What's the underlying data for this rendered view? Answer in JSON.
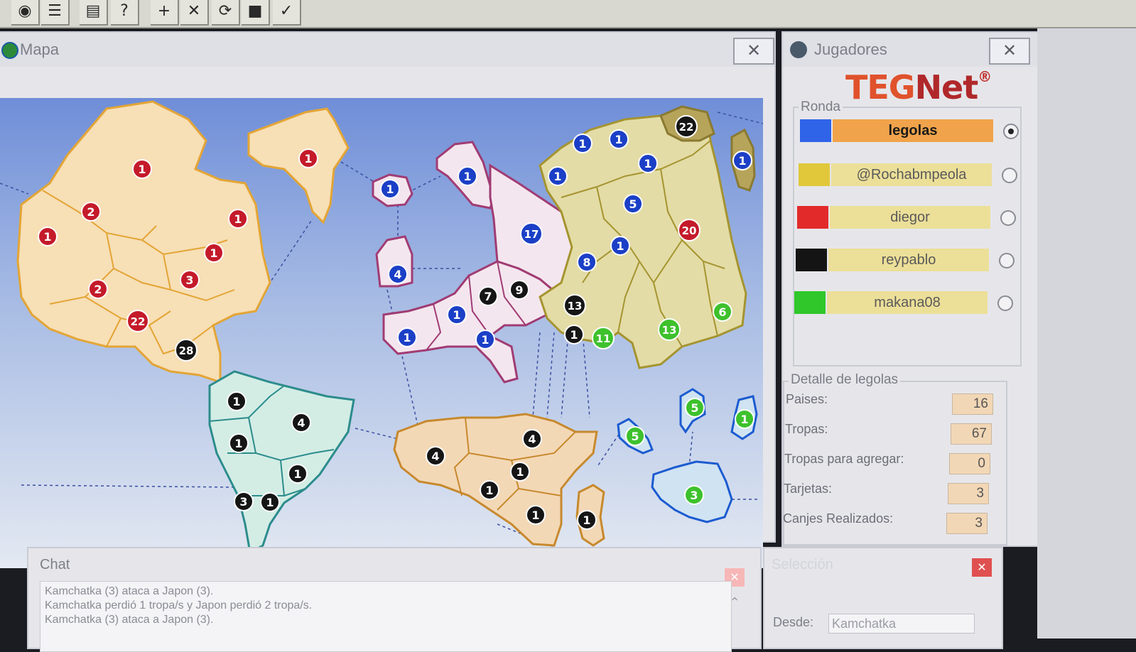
{
  "toolbar": {
    "buttons": [
      {
        "name": "globe-icon",
        "glyph": "◉"
      },
      {
        "name": "list-icon",
        "glyph": "☰"
      },
      {
        "name": "card-icon",
        "glyph": "▤"
      },
      {
        "name": "help-icon",
        "glyph": "?"
      },
      {
        "name": "add-icon",
        "glyph": "+"
      },
      {
        "name": "attack-icon",
        "glyph": "✕"
      },
      {
        "name": "regroup-icon",
        "glyph": "⟳"
      },
      {
        "name": "cards-icon",
        "glyph": "■"
      },
      {
        "name": "end-turn-icon",
        "glyph": "✓"
      }
    ]
  },
  "map_window": {
    "title": "Mapa",
    "close_glyph": "✕"
  },
  "map": {
    "colors": {
      "red": "#c41a2a",
      "blue": "#1b3fc6",
      "black": "#151515",
      "green": "#3ec12d"
    },
    "armies": [
      {
        "owner": "red",
        "count": "1"
      },
      {
        "owner": "red",
        "count": "2"
      },
      {
        "owner": "red",
        "count": "1"
      },
      {
        "owner": "red",
        "count": "1"
      },
      {
        "owner": "red",
        "count": "1"
      },
      {
        "owner": "red",
        "count": "1"
      },
      {
        "owner": "red",
        "count": "3"
      },
      {
        "owner": "red",
        "count": "2"
      },
      {
        "owner": "red",
        "count": "22"
      },
      {
        "owner": "black",
        "count": "28"
      },
      {
        "owner": "black",
        "count": "1"
      },
      {
        "owner": "black",
        "count": "4"
      },
      {
        "owner": "black",
        "count": "1"
      },
      {
        "owner": "black",
        "count": "1"
      },
      {
        "owner": "black",
        "count": "3"
      },
      {
        "owner": "black",
        "count": "1"
      },
      {
        "owner": "blue",
        "count": "1"
      },
      {
        "owner": "blue",
        "count": "4"
      },
      {
        "owner": "blue",
        "count": "1"
      },
      {
        "owner": "blue",
        "count": "1"
      },
      {
        "owner": "blue",
        "count": "17"
      },
      {
        "owner": "black",
        "count": "7"
      },
      {
        "owner": "black",
        "count": "9"
      },
      {
        "owner": "blue",
        "count": "1"
      },
      {
        "owner": "blue",
        "count": "1"
      },
      {
        "owner": "blue",
        "count": "8"
      },
      {
        "owner": "black",
        "count": "13"
      },
      {
        "owner": "black",
        "count": "1"
      },
      {
        "owner": "green",
        "count": "11"
      },
      {
        "owner": "blue",
        "count": "1"
      },
      {
        "owner": "blue",
        "count": "1"
      },
      {
        "owner": "blue",
        "count": "1"
      },
      {
        "owner": "blue",
        "count": "1"
      },
      {
        "owner": "black",
        "count": "22"
      },
      {
        "owner": "blue",
        "count": "1"
      },
      {
        "owner": "blue",
        "count": "5"
      },
      {
        "owner": "red",
        "count": "20"
      },
      {
        "owner": "blue",
        "count": "1"
      },
      {
        "owner": "green",
        "count": "13"
      },
      {
        "owner": "green",
        "count": "6"
      },
      {
        "owner": "black",
        "count": "4"
      },
      {
        "owner": "black",
        "count": "4"
      },
      {
        "owner": "black",
        "count": "1"
      },
      {
        "owner": "black",
        "count": "1"
      },
      {
        "owner": "black",
        "count": "1"
      },
      {
        "owner": "black",
        "count": "1"
      },
      {
        "owner": "green",
        "count": "5"
      },
      {
        "owner": "green",
        "count": "5"
      },
      {
        "owner": "green",
        "count": "1"
      },
      {
        "owner": "green",
        "count": "3"
      }
    ]
  },
  "players_window": {
    "title": "Jugadores",
    "close_glyph": "✕",
    "logo_part1": "TEG",
    "logo_part2": "Net",
    "logo_mark": "®",
    "round_label": "Ronda",
    "players": [
      {
        "name": "legolas",
        "color": "#2f63e8",
        "name_bg": "#f0a34a",
        "selected": true
      },
      {
        "name": "@Rochabmpeola",
        "color": "#e0c83a",
        "name_bg": "#ecdf98",
        "selected": false
      },
      {
        "name": "diegor",
        "color": "#e22a2a",
        "name_bg": "#ecdf98",
        "selected": false
      },
      {
        "name": "reypablo",
        "color": "#141414",
        "name_bg": "#ecdf98",
        "selected": false
      },
      {
        "name": "makana08",
        "color": "#2fc72a",
        "name_bg": "#ecdf98",
        "selected": false
      }
    ],
    "detail_label": "Detalle de legolas",
    "detail": [
      {
        "label": "Paises:",
        "value": "16"
      },
      {
        "label": "Tropas:",
        "value": "67"
      },
      {
        "label": "Tropas para agregar:",
        "value": "0"
      },
      {
        "label": "Tarjetas:",
        "value": "3"
      },
      {
        "label": "Canjes Realizados:",
        "value": "3"
      }
    ]
  },
  "chat": {
    "title": "Chat",
    "close_glyph": "✕",
    "scroll_glyph": "⌃",
    "lines": [
      "Kamchatka (3) ataca a Japon (3).",
      "Kamchatka perdió 1 tropa/s y Japon perdió 2 tropa/s.",
      "Kamchatka (3) ataca a Japon (3)."
    ]
  },
  "selection": {
    "title": "Selección",
    "close_glyph": "✕",
    "from_label": "Desde:",
    "from_value": "Kamchatka"
  }
}
